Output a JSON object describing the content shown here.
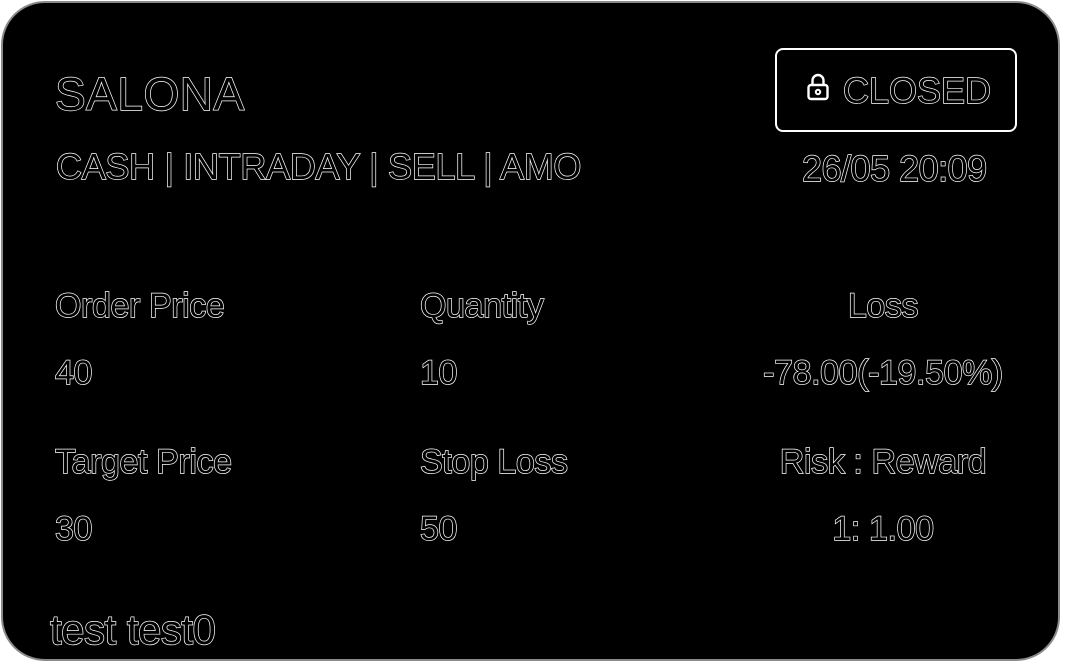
{
  "card": {
    "symbol": "SALONA",
    "meta": "CASH | INTRADAY | SELL | AMO",
    "status": {
      "label": "CLOSED",
      "icon": "lock-icon"
    },
    "datetime": "26/05 20:09",
    "fields": {
      "order_price": {
        "label": "Order Price",
        "value": "40"
      },
      "quantity": {
        "label": "Quantity",
        "value": "10"
      },
      "loss": {
        "label": "Loss",
        "value": "-78.00(-19.50%)"
      },
      "target_price": {
        "label": "Target Price",
        "value": "30"
      },
      "stop_loss": {
        "label": "Stop Loss",
        "value": "50"
      },
      "risk_reward": {
        "label": "Risk : Reward",
        "value": "1: 1.00"
      }
    },
    "user_name": "test test0"
  },
  "colors": {
    "background": "#000000",
    "text_outline": "#ffffff",
    "card_border": "#8a8a8a"
  }
}
